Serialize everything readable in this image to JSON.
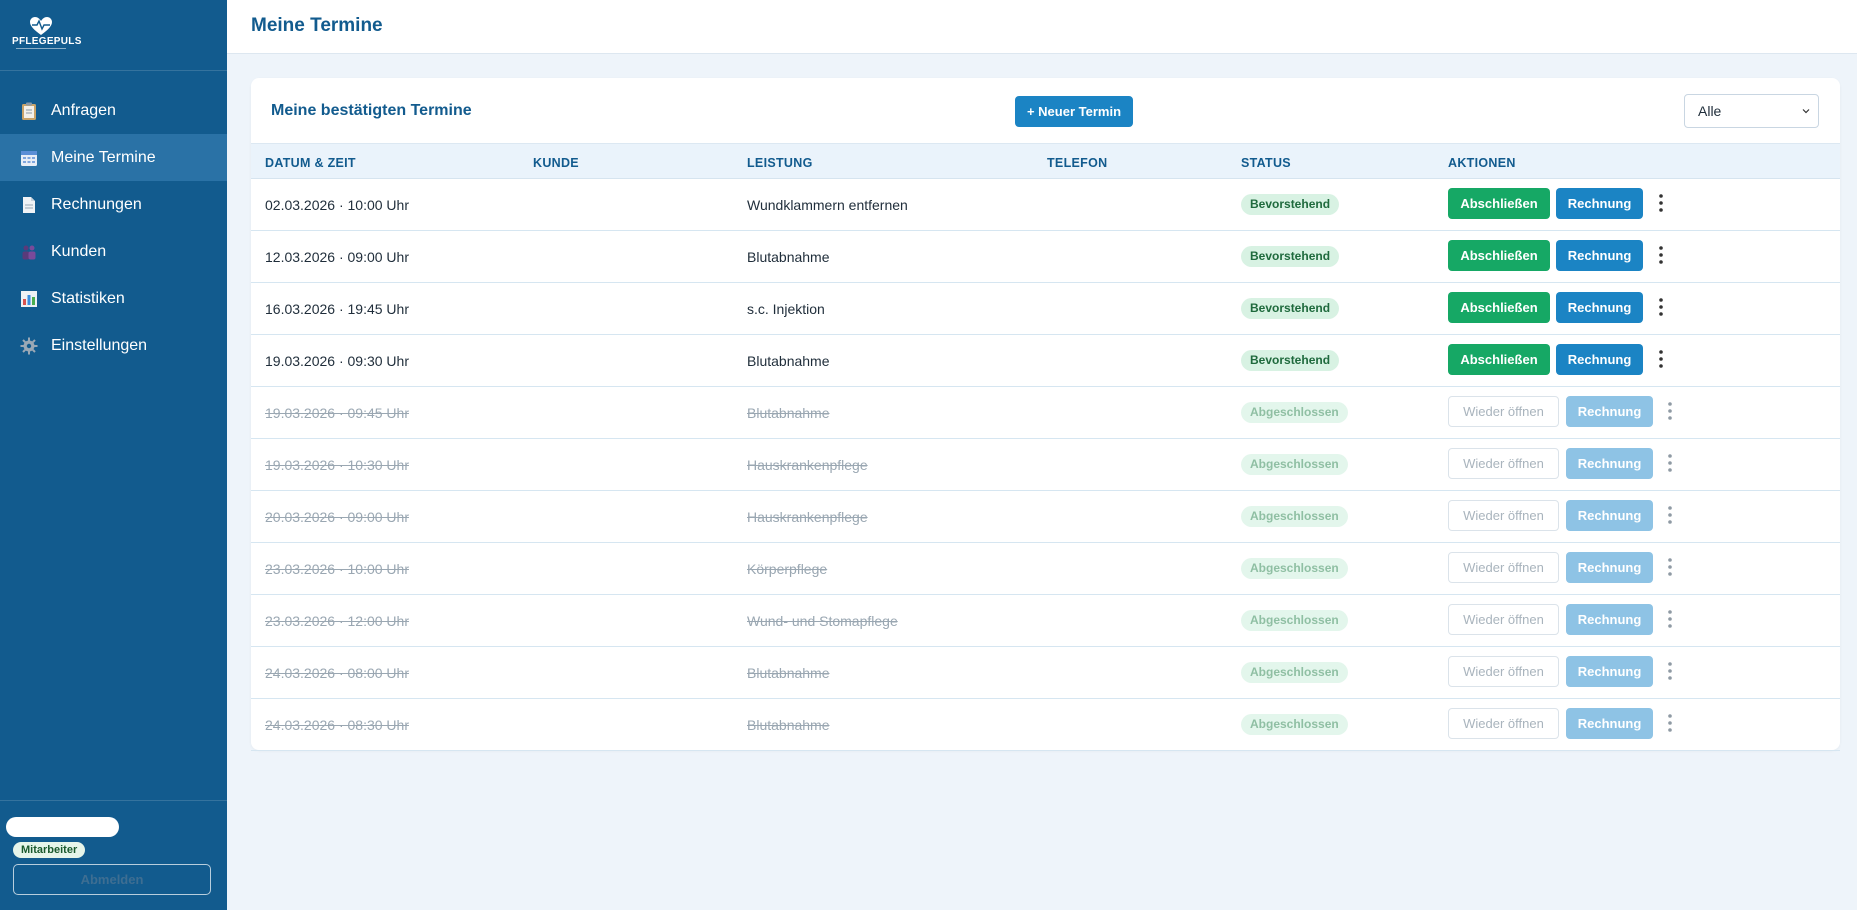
{
  "app": {
    "logo_text": "PFLEGEPULS",
    "page_title": "Meine Termine"
  },
  "sidebar": {
    "items": [
      {
        "label": "Anfragen",
        "icon": "clipboard-icon",
        "active": false
      },
      {
        "label": "Meine Termine",
        "icon": "calendar-icon",
        "active": true
      },
      {
        "label": "Rechnungen",
        "icon": "document-icon",
        "active": false
      },
      {
        "label": "Kunden",
        "icon": "people-icon",
        "active": false
      },
      {
        "label": "Statistiken",
        "icon": "bar-chart-icon",
        "active": false
      },
      {
        "label": "Einstellungen",
        "icon": "gear-icon",
        "active": false
      }
    ],
    "role_badge": "Mitarbeiter",
    "logout_label": "Abmelden"
  },
  "card": {
    "title": "Meine bestätigten Termine",
    "new_button": "+ Neuer Termin",
    "filter_value": "Alle"
  },
  "table": {
    "headers": {
      "datetime": "DATUM & ZEIT",
      "customer": "KUNDE",
      "service": "LEISTUNG",
      "phone": "TELEFON",
      "status": "STATUS",
      "actions": "AKTIONEN"
    },
    "rows": [
      {
        "datetime": "02.03.2026 · 10:00 Uhr",
        "service": "Wundklammern entfernen",
        "status": "Bevorstehend",
        "done": false
      },
      {
        "datetime": "12.03.2026 · 09:00 Uhr",
        "service": "Blutabnahme",
        "status": "Bevorstehend",
        "done": false
      },
      {
        "datetime": "16.03.2026 · 19:45 Uhr",
        "service": "s.c. Injektion",
        "status": "Bevorstehend",
        "done": false
      },
      {
        "datetime": "19.03.2026 · 09:30 Uhr",
        "service": "Blutabnahme",
        "status": "Bevorstehend",
        "done": false
      },
      {
        "datetime": "19.03.2026 · 09:45 Uhr",
        "service": "Blutabnahme",
        "status": "Abgeschlossen",
        "done": true
      },
      {
        "datetime": "19.03.2026 · 10:30 Uhr",
        "service": "Hauskrankenpflege",
        "status": "Abgeschlossen",
        "done": true
      },
      {
        "datetime": "20.03.2026 · 09:00 Uhr",
        "service": "Hauskrankenpflege",
        "status": "Abgeschlossen",
        "done": true
      },
      {
        "datetime": "23.03.2026 · 10:00 Uhr",
        "service": "Körperpflege",
        "status": "Abgeschlossen",
        "done": true
      },
      {
        "datetime": "23.03.2026 · 12:00 Uhr",
        "service": "Wund- und Stomapflege",
        "status": "Abgeschlossen",
        "done": true
      },
      {
        "datetime": "24.03.2026 · 08:00 Uhr",
        "service": "Blutabnahme",
        "status": "Abgeschlossen",
        "done": true
      },
      {
        "datetime": "24.03.2026 · 08:30 Uhr",
        "service": "Blutabnahme",
        "status": "Abgeschlossen",
        "done": true
      }
    ],
    "actions": {
      "complete": "Abschließen",
      "invoice": "Rechnung",
      "reopen": "Wieder öffnen"
    }
  },
  "colors": {
    "sidebar": "#125b8e",
    "primary": "#1b84c4",
    "success": "#16a865"
  }
}
